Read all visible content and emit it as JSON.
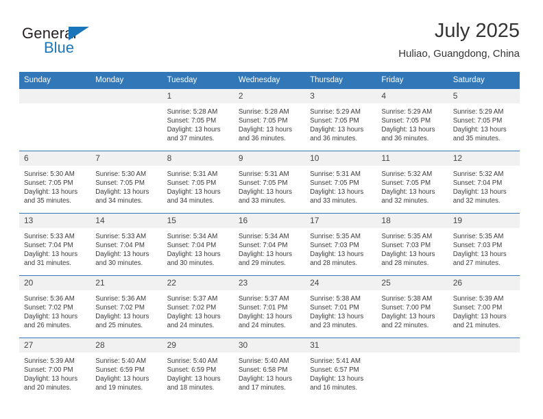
{
  "brand": {
    "name_part1": "General",
    "name_part2": "Blue",
    "triangle_icon": "triangle-icon",
    "accent_color": "#1b75bb"
  },
  "header": {
    "title": "July 2025",
    "location": "Huliao, Guangdong, China"
  },
  "theme": {
    "header_blue": "#3277b8",
    "daynum_gray": "#f1f1f1",
    "text": "#333333"
  },
  "calendar": {
    "weekday_headers": [
      "Sunday",
      "Monday",
      "Tuesday",
      "Wednesday",
      "Thursday",
      "Friday",
      "Saturday"
    ],
    "weeks": [
      [
        {
          "day": "",
          "blank": true,
          "sunrise": "",
          "sunset": "",
          "daylight1": "",
          "daylight2": ""
        },
        {
          "day": "",
          "blank": true,
          "sunrise": "",
          "sunset": "",
          "daylight1": "",
          "daylight2": ""
        },
        {
          "day": "1",
          "sunrise": "Sunrise: 5:28 AM",
          "sunset": "Sunset: 7:05 PM",
          "daylight1": "Daylight: 13 hours",
          "daylight2": "and 37 minutes."
        },
        {
          "day": "2",
          "sunrise": "Sunrise: 5:28 AM",
          "sunset": "Sunset: 7:05 PM",
          "daylight1": "Daylight: 13 hours",
          "daylight2": "and 36 minutes."
        },
        {
          "day": "3",
          "sunrise": "Sunrise: 5:29 AM",
          "sunset": "Sunset: 7:05 PM",
          "daylight1": "Daylight: 13 hours",
          "daylight2": "and 36 minutes."
        },
        {
          "day": "4",
          "sunrise": "Sunrise: 5:29 AM",
          "sunset": "Sunset: 7:05 PM",
          "daylight1": "Daylight: 13 hours",
          "daylight2": "and 36 minutes."
        },
        {
          "day": "5",
          "sunrise": "Sunrise: 5:29 AM",
          "sunset": "Sunset: 7:05 PM",
          "daylight1": "Daylight: 13 hours",
          "daylight2": "and 35 minutes."
        }
      ],
      [
        {
          "day": "6",
          "sunrise": "Sunrise: 5:30 AM",
          "sunset": "Sunset: 7:05 PM",
          "daylight1": "Daylight: 13 hours",
          "daylight2": "and 35 minutes."
        },
        {
          "day": "7",
          "sunrise": "Sunrise: 5:30 AM",
          "sunset": "Sunset: 7:05 PM",
          "daylight1": "Daylight: 13 hours",
          "daylight2": "and 34 minutes."
        },
        {
          "day": "8",
          "sunrise": "Sunrise: 5:31 AM",
          "sunset": "Sunset: 7:05 PM",
          "daylight1": "Daylight: 13 hours",
          "daylight2": "and 34 minutes."
        },
        {
          "day": "9",
          "sunrise": "Sunrise: 5:31 AM",
          "sunset": "Sunset: 7:05 PM",
          "daylight1": "Daylight: 13 hours",
          "daylight2": "and 33 minutes."
        },
        {
          "day": "10",
          "sunrise": "Sunrise: 5:31 AM",
          "sunset": "Sunset: 7:05 PM",
          "daylight1": "Daylight: 13 hours",
          "daylight2": "and 33 minutes."
        },
        {
          "day": "11",
          "sunrise": "Sunrise: 5:32 AM",
          "sunset": "Sunset: 7:05 PM",
          "daylight1": "Daylight: 13 hours",
          "daylight2": "and 32 minutes."
        },
        {
          "day": "12",
          "sunrise": "Sunrise: 5:32 AM",
          "sunset": "Sunset: 7:04 PM",
          "daylight1": "Daylight: 13 hours",
          "daylight2": "and 32 minutes."
        }
      ],
      [
        {
          "day": "13",
          "sunrise": "Sunrise: 5:33 AM",
          "sunset": "Sunset: 7:04 PM",
          "daylight1": "Daylight: 13 hours",
          "daylight2": "and 31 minutes."
        },
        {
          "day": "14",
          "sunrise": "Sunrise: 5:33 AM",
          "sunset": "Sunset: 7:04 PM",
          "daylight1": "Daylight: 13 hours",
          "daylight2": "and 30 minutes."
        },
        {
          "day": "15",
          "sunrise": "Sunrise: 5:34 AM",
          "sunset": "Sunset: 7:04 PM",
          "daylight1": "Daylight: 13 hours",
          "daylight2": "and 30 minutes."
        },
        {
          "day": "16",
          "sunrise": "Sunrise: 5:34 AM",
          "sunset": "Sunset: 7:04 PM",
          "daylight1": "Daylight: 13 hours",
          "daylight2": "and 29 minutes."
        },
        {
          "day": "17",
          "sunrise": "Sunrise: 5:35 AM",
          "sunset": "Sunset: 7:03 PM",
          "daylight1": "Daylight: 13 hours",
          "daylight2": "and 28 minutes."
        },
        {
          "day": "18",
          "sunrise": "Sunrise: 5:35 AM",
          "sunset": "Sunset: 7:03 PM",
          "daylight1": "Daylight: 13 hours",
          "daylight2": "and 28 minutes."
        },
        {
          "day": "19",
          "sunrise": "Sunrise: 5:35 AM",
          "sunset": "Sunset: 7:03 PM",
          "daylight1": "Daylight: 13 hours",
          "daylight2": "and 27 minutes."
        }
      ],
      [
        {
          "day": "20",
          "sunrise": "Sunrise: 5:36 AM",
          "sunset": "Sunset: 7:02 PM",
          "daylight1": "Daylight: 13 hours",
          "daylight2": "and 26 minutes."
        },
        {
          "day": "21",
          "sunrise": "Sunrise: 5:36 AM",
          "sunset": "Sunset: 7:02 PM",
          "daylight1": "Daylight: 13 hours",
          "daylight2": "and 25 minutes."
        },
        {
          "day": "22",
          "sunrise": "Sunrise: 5:37 AM",
          "sunset": "Sunset: 7:02 PM",
          "daylight1": "Daylight: 13 hours",
          "daylight2": "and 24 minutes."
        },
        {
          "day": "23",
          "sunrise": "Sunrise: 5:37 AM",
          "sunset": "Sunset: 7:01 PM",
          "daylight1": "Daylight: 13 hours",
          "daylight2": "and 24 minutes."
        },
        {
          "day": "24",
          "sunrise": "Sunrise: 5:38 AM",
          "sunset": "Sunset: 7:01 PM",
          "daylight1": "Daylight: 13 hours",
          "daylight2": "and 23 minutes."
        },
        {
          "day": "25",
          "sunrise": "Sunrise: 5:38 AM",
          "sunset": "Sunset: 7:00 PM",
          "daylight1": "Daylight: 13 hours",
          "daylight2": "and 22 minutes."
        },
        {
          "day": "26",
          "sunrise": "Sunrise: 5:39 AM",
          "sunset": "Sunset: 7:00 PM",
          "daylight1": "Daylight: 13 hours",
          "daylight2": "and 21 minutes."
        }
      ],
      [
        {
          "day": "27",
          "sunrise": "Sunrise: 5:39 AM",
          "sunset": "Sunset: 7:00 PM",
          "daylight1": "Daylight: 13 hours",
          "daylight2": "and 20 minutes."
        },
        {
          "day": "28",
          "sunrise": "Sunrise: 5:40 AM",
          "sunset": "Sunset: 6:59 PM",
          "daylight1": "Daylight: 13 hours",
          "daylight2": "and 19 minutes."
        },
        {
          "day": "29",
          "sunrise": "Sunrise: 5:40 AM",
          "sunset": "Sunset: 6:59 PM",
          "daylight1": "Daylight: 13 hours",
          "daylight2": "and 18 minutes."
        },
        {
          "day": "30",
          "sunrise": "Sunrise: 5:40 AM",
          "sunset": "Sunset: 6:58 PM",
          "daylight1": "Daylight: 13 hours",
          "daylight2": "and 17 minutes."
        },
        {
          "day": "31",
          "sunrise": "Sunrise: 5:41 AM",
          "sunset": "Sunset: 6:57 PM",
          "daylight1": "Daylight: 13 hours",
          "daylight2": "and 16 minutes."
        },
        {
          "day": "",
          "blank": true,
          "sunrise": "",
          "sunset": "",
          "daylight1": "",
          "daylight2": ""
        },
        {
          "day": "",
          "blank": true,
          "sunrise": "",
          "sunset": "",
          "daylight1": "",
          "daylight2": ""
        }
      ]
    ]
  }
}
